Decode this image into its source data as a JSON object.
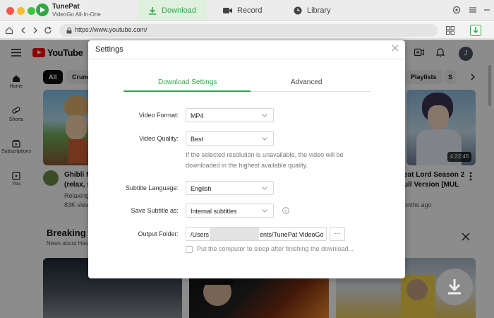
{
  "app": {
    "name": "TunePat",
    "subtitle": "VideoGo All-In-One",
    "tabs": [
      {
        "label": "Download",
        "icon": "download-icon",
        "active": true
      },
      {
        "label": "Record",
        "icon": "camera-icon",
        "active": false
      },
      {
        "label": "Library",
        "icon": "clock-icon",
        "active": false
      }
    ],
    "accent_color": "#2fa845"
  },
  "browser": {
    "url": "https://www.youtube.com/"
  },
  "youtube": {
    "logo_text": "YouTube",
    "sidebar": [
      {
        "label": "Home",
        "icon": "home-icon"
      },
      {
        "label": "Shorts",
        "icon": "shorts-icon"
      },
      {
        "label": "Subscriptions",
        "icon": "subscriptions-icon"
      },
      {
        "label": "You",
        "icon": "you-icon"
      }
    ],
    "chips": {
      "first": "All",
      "second": "Crunc",
      "right": "Playlists",
      "right_partial": "S"
    },
    "avatar_letter": "J",
    "video_left": {
      "title1": "Ghibli M",
      "title2": "(relax, s",
      "channel": "Relaxing",
      "views": "83K view"
    },
    "video_right": {
      "title1": "eat Lord Season 2",
      "title2": "ull Version [MUL",
      "meta": "onths ago",
      "duration": "4:22:45"
    },
    "breaking": {
      "title": "Breaking n",
      "sub": "News about Hass"
    }
  },
  "dialog": {
    "title": "Settings",
    "tabs": {
      "download": "Download Settings",
      "advanced": "Advanced"
    },
    "video_format": {
      "label": "Video Format:",
      "value": "MP4"
    },
    "video_quality": {
      "label": "Video Quality:",
      "value": "Best"
    },
    "quality_note": "If the selected resolution is unavailable, the video will be downloaded in the highest available quality.",
    "subtitle_language": {
      "label": "Subtitle Language:",
      "value": "English"
    },
    "save_subtitle": {
      "label": "Save Subtitle as:",
      "value": "Internal subtitles"
    },
    "output_folder": {
      "label": "Output Folder:",
      "path_start": "/Users",
      "path_end": "ents/TunePat VideoGo",
      "browse": "···"
    },
    "sleep_option": "Put the computer to sleep after finishing the download..."
  }
}
